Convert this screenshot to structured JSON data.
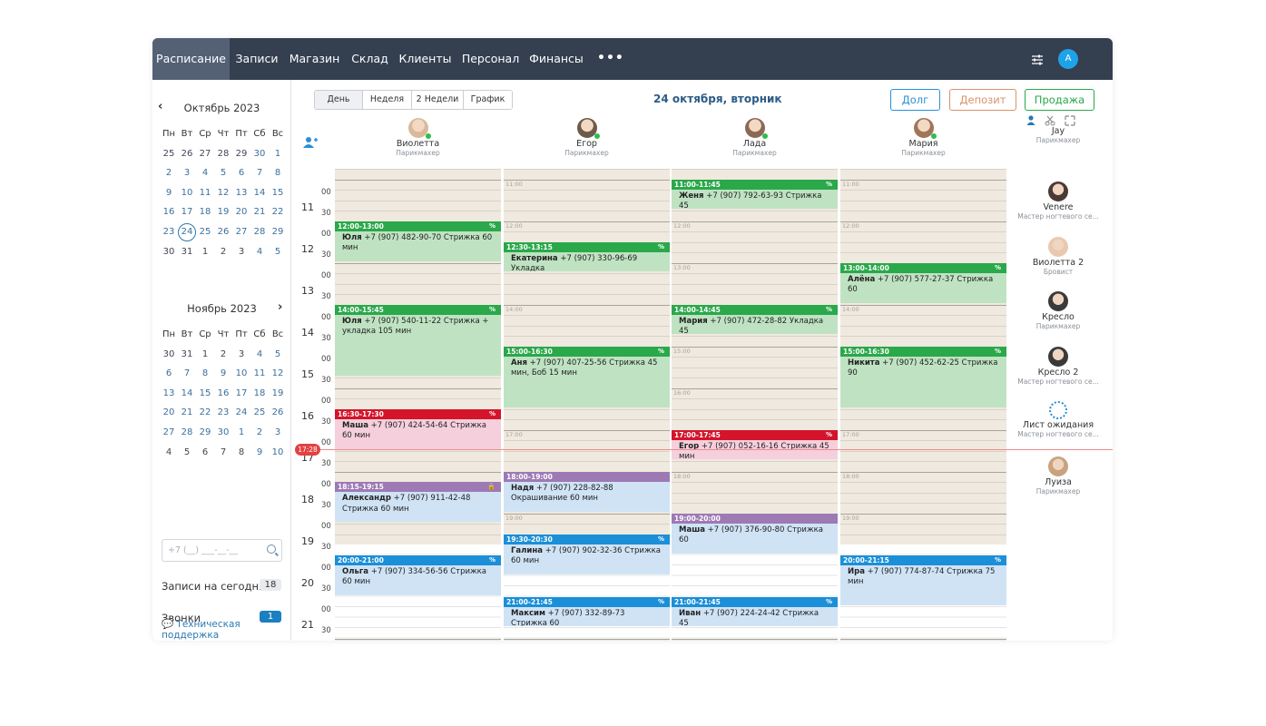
{
  "nav": {
    "items": [
      "Расписание",
      "Записи",
      "Магазин",
      "Склад",
      "Клиенты",
      "Персонал",
      "Финансы"
    ],
    "more": "•••",
    "avatar_letter": "A"
  },
  "calendar_oct": {
    "title": "Октябрь 2023",
    "weekdays": [
      "Пн",
      "Вт",
      "Ср",
      "Чт",
      "Пт",
      "Сб",
      "Вс"
    ],
    "weeks": [
      [
        "25",
        "26",
        "27",
        "28",
        "29",
        "30",
        "1"
      ],
      [
        "2",
        "3",
        "4",
        "5",
        "6",
        "7",
        "8"
      ],
      [
        "9",
        "10",
        "11",
        "12",
        "13",
        "14",
        "15"
      ],
      [
        "16",
        "17",
        "18",
        "19",
        "20",
        "21",
        "22"
      ],
      [
        "23",
        "24",
        "25",
        "26",
        "27",
        "28",
        "29"
      ],
      [
        "30",
        "31",
        "1",
        "2",
        "3",
        "4",
        "5"
      ]
    ],
    "today": "24"
  },
  "calendar_nov": {
    "title": "Ноябрь 2023",
    "weekdays": [
      "Пн",
      "Вт",
      "Ср",
      "Чт",
      "Пт",
      "Сб",
      "Вс"
    ],
    "weeks": [
      [
        "30",
        "31",
        "1",
        "2",
        "3",
        "4",
        "5"
      ],
      [
        "6",
        "7",
        "8",
        "9",
        "10",
        "11",
        "12"
      ],
      [
        "13",
        "14",
        "15",
        "16",
        "17",
        "18",
        "19"
      ],
      [
        "20",
        "21",
        "22",
        "23",
        "24",
        "25",
        "26"
      ],
      [
        "27",
        "28",
        "29",
        "30",
        "1",
        "2",
        "3"
      ],
      [
        "4",
        "5",
        "6",
        "7",
        "8",
        "9",
        "10"
      ]
    ]
  },
  "sidebar": {
    "phone_placeholder": "+7 (__) ___-__-__",
    "today_label": "Записи на сегодня",
    "today_count": "18",
    "calls_label": "Звонки",
    "calls_count": "1",
    "support_label": "Техническая поддержка"
  },
  "toolbar": {
    "tabs": [
      "День",
      "Неделя",
      "2 Недели",
      "График"
    ],
    "date_title": "24 октября, вторник",
    "debt_label": "Долг",
    "deposit_label": "Депозит",
    "sale_label": "Продажа"
  },
  "staff": [
    {
      "name": "Виолетта",
      "role": "Парикмахер"
    },
    {
      "name": "Егор",
      "role": "Парикмахер"
    },
    {
      "name": "Лада",
      "role": "Парикмахер"
    },
    {
      "name": "Мария",
      "role": "Парикмахер"
    }
  ],
  "hours": [
    "11",
    "12",
    "13",
    "14",
    "15",
    "16",
    "17",
    "18",
    "19",
    "20",
    "21"
  ],
  "current_time": "17:28",
  "ghost_times": [
    "11:00",
    "12:00",
    "13:00",
    "14:00",
    "15:00",
    "16:00",
    "17:00",
    "18:00",
    "19:00",
    "20:00"
  ],
  "appointments": [
    {
      "col": 0,
      "time": "12:00-13:00",
      "client": "Юля",
      "details": "+7 (907) 482-90-70 Стрижка 60 мин",
      "color": "#2aa84a",
      "bg": "#bfe3c2",
      "start": 12.0,
      "end": 13.0,
      "icon": "%"
    },
    {
      "col": 0,
      "time": "14:00-15:45",
      "client": "Юля",
      "details": "+7 (907) 540-11-22 Стрижка + укладка 105 мин",
      "color": "#2aa84a",
      "bg": "#bfe3c2",
      "start": 14.0,
      "end": 15.75,
      "icon": "%"
    },
    {
      "col": 0,
      "time": "16:30-17:30",
      "client": "Маша",
      "details": "+7 (907) 424-54-64 Стрижка 60 мин",
      "color": "#d4142a",
      "bg": "#f5cfdc",
      "start": 16.5,
      "end": 17.5,
      "icon": "%"
    },
    {
      "col": 0,
      "time": "18:15-19:15",
      "client": "Александр",
      "details": "+7 (907) 911-42-48 Стрижка 60 мин",
      "color": "#9d7ab4",
      "bg": "#cfe3f5",
      "start": 18.25,
      "end": 19.25,
      "icon": "🔒"
    },
    {
      "col": 0,
      "time": "20:00-21:00",
      "client": "Ольга",
      "details": "+7 (907) 334-56-56 Стрижка 60 мин",
      "color": "#1b8fd8",
      "bg": "#cfe3f5",
      "start": 20.0,
      "end": 21.0,
      "icon": "%"
    },
    {
      "col": 1,
      "time": "12:30-13:15",
      "client": "Екатерина",
      "details": "+7 (907) 330-96-69 Укладка",
      "color": "#2aa84a",
      "bg": "#bfe3c2",
      "start": 12.5,
      "end": 13.25,
      "icon": "%"
    },
    {
      "col": 1,
      "time": "15:00-16:30",
      "client": "Аня",
      "details": "+7 (907) 407-25-56 Стрижка 45 мин, Боб 15 мин",
      "color": "#2aa84a",
      "bg": "#bfe3c2",
      "start": 15.0,
      "end": 16.5,
      "icon": "%"
    },
    {
      "col": 1,
      "time": "18:00-19:00",
      "client": "Надя",
      "details": "+7 (907) 228-82-88 Окрашивание 60 мин",
      "color": "#9d7ab4",
      "bg": "#cfe3f5",
      "start": 18.0,
      "end": 19.0,
      "icon": ""
    },
    {
      "col": 1,
      "time": "19:30-20:30",
      "client": "Галина",
      "details": "+7 (907) 902-32-36 Стрижка 60 мин",
      "color": "#1b8fd8",
      "bg": "#cfe3f5",
      "start": 19.5,
      "end": 20.5,
      "icon": "%"
    },
    {
      "col": 1,
      "time": "21:00-21:45",
      "client": "Максим",
      "details": "+7 (907) 332-89-73 Стрижка 60",
      "color": "#1b8fd8",
      "bg": "#cfe3f5",
      "start": 21.0,
      "end": 21.75,
      "icon": "%"
    },
    {
      "col": 2,
      "time": "11:00-11:45",
      "client": "Женя",
      "details": "+7 (907) 792-63-93 Стрижка 45",
      "color": "#2aa84a",
      "bg": "#bfe3c2",
      "start": 11.0,
      "end": 11.75,
      "icon": "%"
    },
    {
      "col": 2,
      "time": "14:00-14:45",
      "client": "Мария",
      "details": "+7 (907) 472-28-82 Укладка 45",
      "color": "#2aa84a",
      "bg": "#bfe3c2",
      "start": 14.0,
      "end": 14.75,
      "icon": "%"
    },
    {
      "col": 2,
      "time": "17:00-17:45",
      "client": "Егор",
      "details": "+7 (907) 052-16-16 Стрижка 45 мин",
      "color": "#d4142a",
      "bg": "#f5cfdc",
      "start": 17.0,
      "end": 17.75,
      "icon": "%"
    },
    {
      "col": 2,
      "time": "19:00-20:00",
      "client": "Маша",
      "details": "+7 (907) 376-90-80 Стрижка 60",
      "color": "#9d7ab4",
      "bg": "#cfe3f5",
      "start": 19.0,
      "end": 20.0,
      "icon": ""
    },
    {
      "col": 2,
      "time": "21:00-21:45",
      "client": "Иван",
      "details": "+7 (907) 224-24-42 Стрижка 45",
      "color": "#1b8fd8",
      "bg": "#cfe3f5",
      "start": 21.0,
      "end": 21.75,
      "icon": "%"
    },
    {
      "col": 3,
      "time": "13:00-14:00",
      "client": "Алёна",
      "details": "+7 (907) 577-27-37 Стрижка 60",
      "color": "#2aa84a",
      "bg": "#bfe3c2",
      "start": 13.0,
      "end": 14.0,
      "icon": "%"
    },
    {
      "col": 3,
      "time": "15:00-16:30",
      "client": "Никита",
      "details": "+7 (907) 452-62-25 Стрижка 90",
      "color": "#2aa84a",
      "bg": "#bfe3c2",
      "start": 15.0,
      "end": 16.5,
      "icon": "%"
    },
    {
      "col": 3,
      "time": "20:00-21:15",
      "client": "Ира",
      "details": "+7 (907) 774-87-74 Стрижка 75 мин",
      "color": "#1b8fd8",
      "bg": "#cfe3f5",
      "start": 20.0,
      "end": 21.25,
      "icon": "%"
    }
  ],
  "resources": [
    {
      "name": "Jay",
      "role": "Парикмахер"
    },
    {
      "name": "Venere",
      "role": "Мастер ногтевого се..."
    },
    {
      "name": "Виолетта 2",
      "role": "Бровист"
    },
    {
      "name": "Кресло",
      "role": "Парикмахер"
    },
    {
      "name": "Кресло 2",
      "role": "Мастер ногтевого се..."
    },
    {
      "name": "Лист ожидания",
      "role": "Мастер ногтевого се..."
    },
    {
      "name": "Луиза",
      "role": "Парикмахер"
    }
  ],
  "colors": {
    "topbar": "#343f50",
    "accent": "#2a7ab0",
    "green": "#2aa84a",
    "red": "#d4142a",
    "purple": "#9d7ab4",
    "blue": "#1b8fd8"
  }
}
